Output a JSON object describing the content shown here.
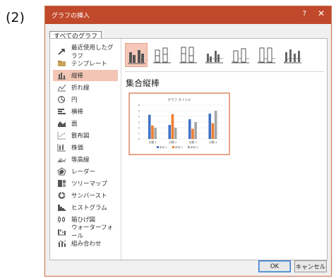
{
  "step_label": "(2)",
  "dialog": {
    "title": "グラフの挿入",
    "help_label": "?",
    "close_label": "✕",
    "tab_label": "すべてのグラフ"
  },
  "sidebar": {
    "items": [
      {
        "label": "最近使用したグラフ",
        "icon": "recent-icon"
      },
      {
        "label": "テンプレート",
        "icon": "folder-icon"
      },
      {
        "label": "縦棒",
        "icon": "column-chart-icon",
        "selected": true
      },
      {
        "label": "折れ線",
        "icon": "line-chart-icon"
      },
      {
        "label": "円",
        "icon": "pie-chart-icon"
      },
      {
        "label": "横棒",
        "icon": "bar-chart-icon"
      },
      {
        "label": "面",
        "icon": "area-chart-icon"
      },
      {
        "label": "散布図",
        "icon": "scatter-chart-icon"
      },
      {
        "label": "株価",
        "icon": "stock-chart-icon"
      },
      {
        "label": "等高線",
        "icon": "surface-chart-icon"
      },
      {
        "label": "レーダー",
        "icon": "radar-chart-icon"
      },
      {
        "label": "ツリーマップ",
        "icon": "treemap-icon"
      },
      {
        "label": "サンバースト",
        "icon": "sunburst-icon"
      },
      {
        "label": "ヒストグラム",
        "icon": "histogram-icon"
      },
      {
        "label": "箱ひげ図",
        "icon": "box-whisker-icon"
      },
      {
        "label": "ウォーターフォール",
        "icon": "waterfall-icon"
      },
      {
        "label": "組み合わせ",
        "icon": "combo-chart-icon"
      }
    ]
  },
  "main": {
    "heading": "集合縦棒",
    "subtypes": [
      "clustered-column",
      "stacked-column",
      "100-stacked-column",
      "3d-clustered-column",
      "3d-stacked-column",
      "3d-100-stacked-column",
      "3d-column"
    ]
  },
  "buttons": {
    "ok": "OK",
    "cancel": "キャンセル"
  },
  "colors": {
    "accent": "#c0492b",
    "selection": "#f2c5b5",
    "series1": "#4472c4",
    "series2": "#ed7d31",
    "series3": "#a5a5a5"
  },
  "chart_data": {
    "type": "bar",
    "title": "グラフ タイトル",
    "categories": [
      "分類 1",
      "分類 2",
      "分類 3",
      "分類 4"
    ],
    "series": [
      {
        "name": "系列 1",
        "values": [
          4.3,
          2.5,
          3.5,
          4.5
        ]
      },
      {
        "name": "系列 2",
        "values": [
          2.4,
          4.4,
          1.8,
          2.8
        ]
      },
      {
        "name": "系列 3",
        "values": [
          2,
          2,
          3,
          5
        ]
      }
    ],
    "yticks": [
      "6",
      "5",
      "4",
      "3",
      "2",
      "1",
      "0"
    ],
    "ylim": [
      0,
      6
    ],
    "legend": "bottom",
    "grid": true
  }
}
